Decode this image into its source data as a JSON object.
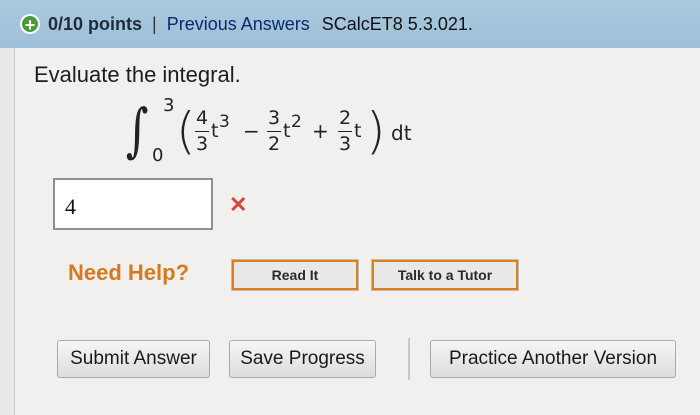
{
  "header": {
    "points": "0/10 points",
    "separator": "|",
    "previous_answers": "Previous Answers",
    "course_code": "SCalcET8 5.3.021."
  },
  "question": {
    "prompt": "Evaluate the integral.",
    "integral": {
      "upper_limit": "3",
      "lower_limit": "0",
      "term1_num": "4",
      "term1_den": "3",
      "term1_var": "t",
      "term1_exp": "3",
      "op1": "−",
      "term2_num": "3",
      "term2_den": "2",
      "term2_var": "t",
      "term2_exp": "2",
      "op2": "+",
      "term3_num": "2",
      "term3_den": "3",
      "term3_var": "t",
      "differential": "dt"
    }
  },
  "answer": {
    "value": "4",
    "status": "incorrect",
    "status_color": "#d8433c"
  },
  "help": {
    "label": "Need Help?",
    "read_it": "Read It",
    "talk_to_tutor": "Talk to a Tutor"
  },
  "actions": {
    "submit": "Submit Answer",
    "save": "Save Progress",
    "practice": "Practice Another Version"
  },
  "colors": {
    "header_bg": "#a9c9df",
    "help_orange": "#d7791e",
    "points_icon": "#4a9a3e"
  }
}
